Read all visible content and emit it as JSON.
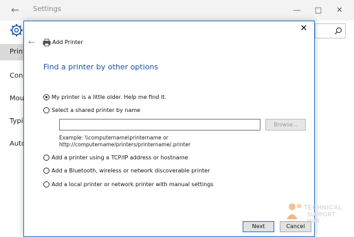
{
  "settings": {
    "title": "Settings",
    "nav_items": [
      "Printe",
      "Con",
      "Mou",
      "Typi",
      "Auto"
    ],
    "icons": {
      "back": "back-arrow-icon",
      "gear": "gear-icon",
      "search": "search-icon",
      "minimize": "minimize-icon",
      "maximize": "maximize-icon",
      "close": "close-icon"
    }
  },
  "dialog": {
    "title": "Add Printer",
    "heading": "Find a printer by other options",
    "options": [
      {
        "label": "My printer is a little older. Help me find it.",
        "selected": true
      },
      {
        "label": "Select a shared printer by name",
        "selected": false
      },
      {
        "label": "Add a printer using a TCP/IP address or hostname",
        "selected": false
      },
      {
        "label": "Add a Bluetooth, wireless or network discoverable printer",
        "selected": false
      },
      {
        "label": "Add a local printer or network printer with manual settings",
        "selected": false
      }
    ],
    "share_input": {
      "value": "",
      "placeholder": ""
    },
    "browse_label": "Browse...",
    "example_line1": "Example: \\\\computername\\printername or",
    "example_line2": "http://computername/printers/printername/.printer",
    "next_label": "Next",
    "cancel_label": "Cancel"
  },
  "watermark": {
    "line1": "TECHNICAL",
    "line2": "SUPPORT HUB"
  },
  "colors": {
    "accent": "#2a72c9",
    "heading": "#1a4fa0",
    "desktop": "#1f4f86"
  }
}
